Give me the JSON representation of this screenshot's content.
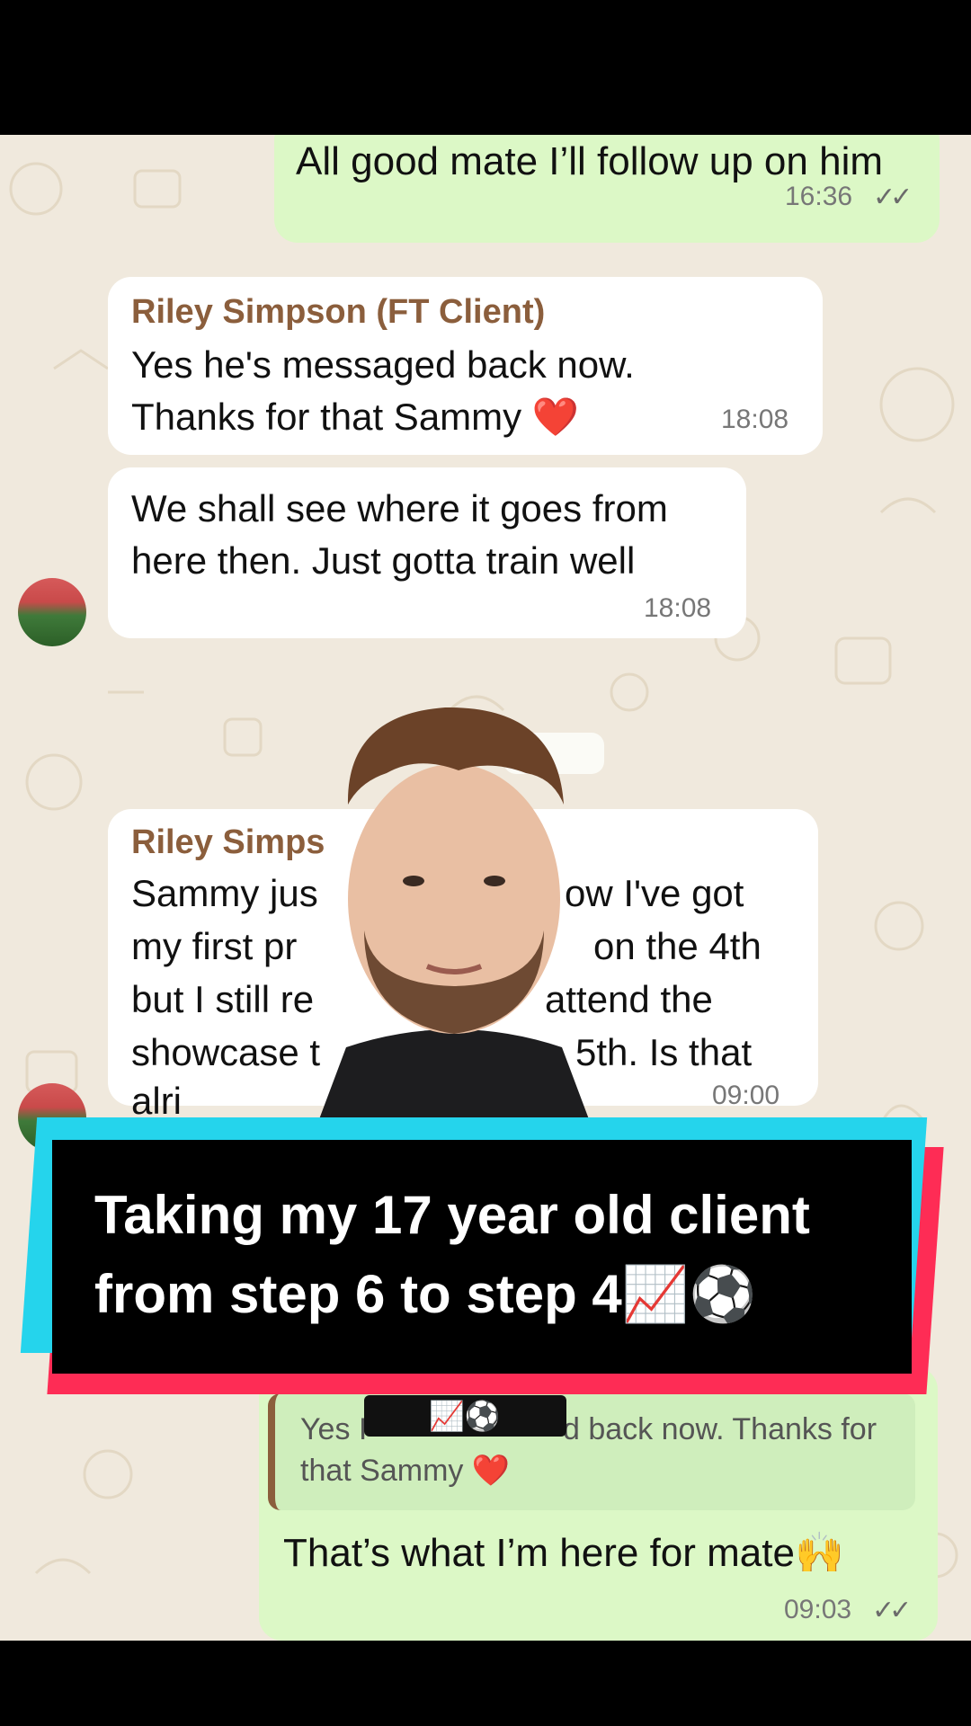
{
  "chat": {
    "msg1": {
      "text": "All good mate I’ll follow up on him",
      "time": "16:36",
      "ticks": "✓✓"
    },
    "msg2": {
      "sender": "Riley Simpson (FT Client)",
      "line1": "Yes he's messaged back now.",
      "line2": "Thanks for that Sammy ❤️",
      "time": "18:08"
    },
    "msg3": {
      "line1": "We shall see where it goes from",
      "line2": "here then. Just gotta train well",
      "time": "18:08"
    },
    "msg4": {
      "sender": "Riley Simps",
      "line1a": "Sammy jus",
      "line1b": "ow I've got",
      "line2a": "my first pr",
      "line2b": "on the 4th",
      "line3a": "but I still re",
      "line3b": "attend the",
      "line4a": "showcase t",
      "line4b": "5th. Is that",
      "line5a": "alri",
      "time": "09:00"
    },
    "reply": {
      "quote_line1a": "Yes I",
      "quote_line1b": "d back now. Thanks for",
      "quote_line2": "that Sammy ❤️",
      "text": "That’s what I’m here for mate🙌",
      "time": "09:03",
      "ticks": "✓✓"
    }
  },
  "caption": {
    "line1": "Taking my 17 year old client",
    "line2": "from step 6 to step 4📈⚽"
  },
  "sticker": "📈⚽",
  "colors": {
    "outgoing": "#dcf8c6",
    "incoming": "#ffffff",
    "sender": "#8b5e3c",
    "caption_cyan": "#25d4ec",
    "caption_red": "#fe2c55"
  }
}
